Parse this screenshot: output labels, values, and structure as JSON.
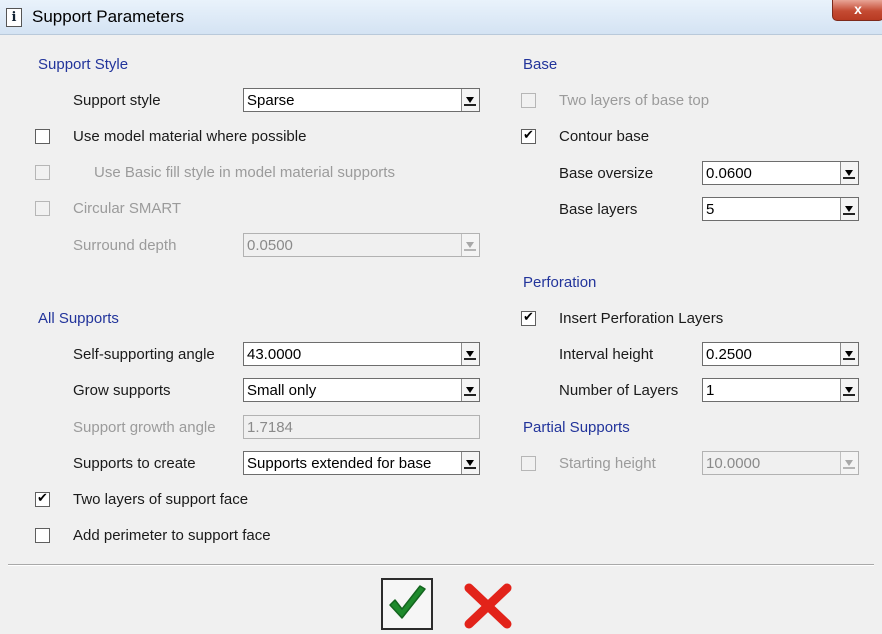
{
  "window": {
    "title": "Support Parameters",
    "icon": "info-icon",
    "close_label": "x"
  },
  "support_style": {
    "heading": "Support Style",
    "style_label": "Support style",
    "style_value": "Sparse",
    "use_model_material_label": "Use model material where possible",
    "use_model_material_checked": false,
    "basic_fill_label": "Use Basic fill style in model material supports",
    "circular_smart_label": "Circular SMART",
    "surround_depth_label": "Surround depth",
    "surround_depth_value": "0.0500"
  },
  "all_supports": {
    "heading": "All Supports",
    "self_supporting_label": "Self-supporting angle",
    "self_supporting_value": "43.0000",
    "grow_label": "Grow supports",
    "grow_value": "Small only",
    "growth_angle_label": "Support growth angle",
    "growth_angle_value": "1.7184",
    "to_create_label": "Supports to create",
    "to_create_value": "Supports extended for base",
    "two_layers_label": "Two layers of support face",
    "two_layers_checked": true,
    "add_perimeter_label": "Add perimeter to support face",
    "add_perimeter_checked": false
  },
  "base": {
    "heading": "Base",
    "two_layers_top_label": "Two layers of base top",
    "contour_label": "Contour base",
    "contour_checked": true,
    "oversize_label": "Base oversize",
    "oversize_value": "0.0600",
    "layers_label": "Base layers",
    "layers_value": "5"
  },
  "perforation": {
    "heading": "Perforation",
    "insert_label": "Insert Perforation Layers",
    "insert_checked": true,
    "interval_label": "Interval height",
    "interval_value": "0.2500",
    "num_layers_label": "Number of Layers",
    "num_layers_value": "1"
  },
  "partial_supports": {
    "heading": "Partial Supports",
    "starting_height_label": "Starting height",
    "starting_height_value": "10.0000"
  },
  "buttons": {
    "ok_icon": "checkmark-icon",
    "cancel_icon": "red-x-icon"
  },
  "colors": {
    "section_heading": "#22349b",
    "ok_green": "#1e8a2c",
    "cancel_red": "#e2231a"
  },
  "checkmark_glyph": "✔"
}
